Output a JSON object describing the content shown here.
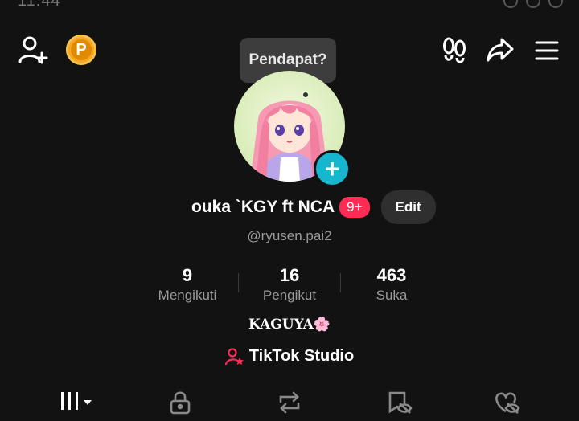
{
  "status_bar": {
    "time": "11:44"
  },
  "header": {
    "add_friend_icon": "person-add-icon",
    "points_letter": "P",
    "footprint_icon": "footprint-icon",
    "share_icon": "share-icon",
    "menu_icon": "menu-icon"
  },
  "tooltip": {
    "text": "Pendapat?"
  },
  "profile": {
    "avatar_add_label": "+",
    "display_name": "ouka `KGY ft NCA",
    "badge": "9+",
    "edit_label": "Edit",
    "username": "@ryusen.pai2"
  },
  "stats": [
    {
      "value": "9",
      "label": "Mengikuti"
    },
    {
      "value": "16",
      "label": "Pengikut"
    },
    {
      "value": "463",
      "label": "Suka"
    }
  ],
  "bio": "KAGUYA🌸",
  "studio": {
    "label": "TikTok Studio"
  },
  "tabs": [
    "videos-tab",
    "private-tab",
    "reposts-tab",
    "favorites-tab",
    "liked-tab"
  ],
  "colors": {
    "accent": "#fe2c55",
    "avatar_plus": "#17b6cf",
    "points": "#f5a623"
  }
}
